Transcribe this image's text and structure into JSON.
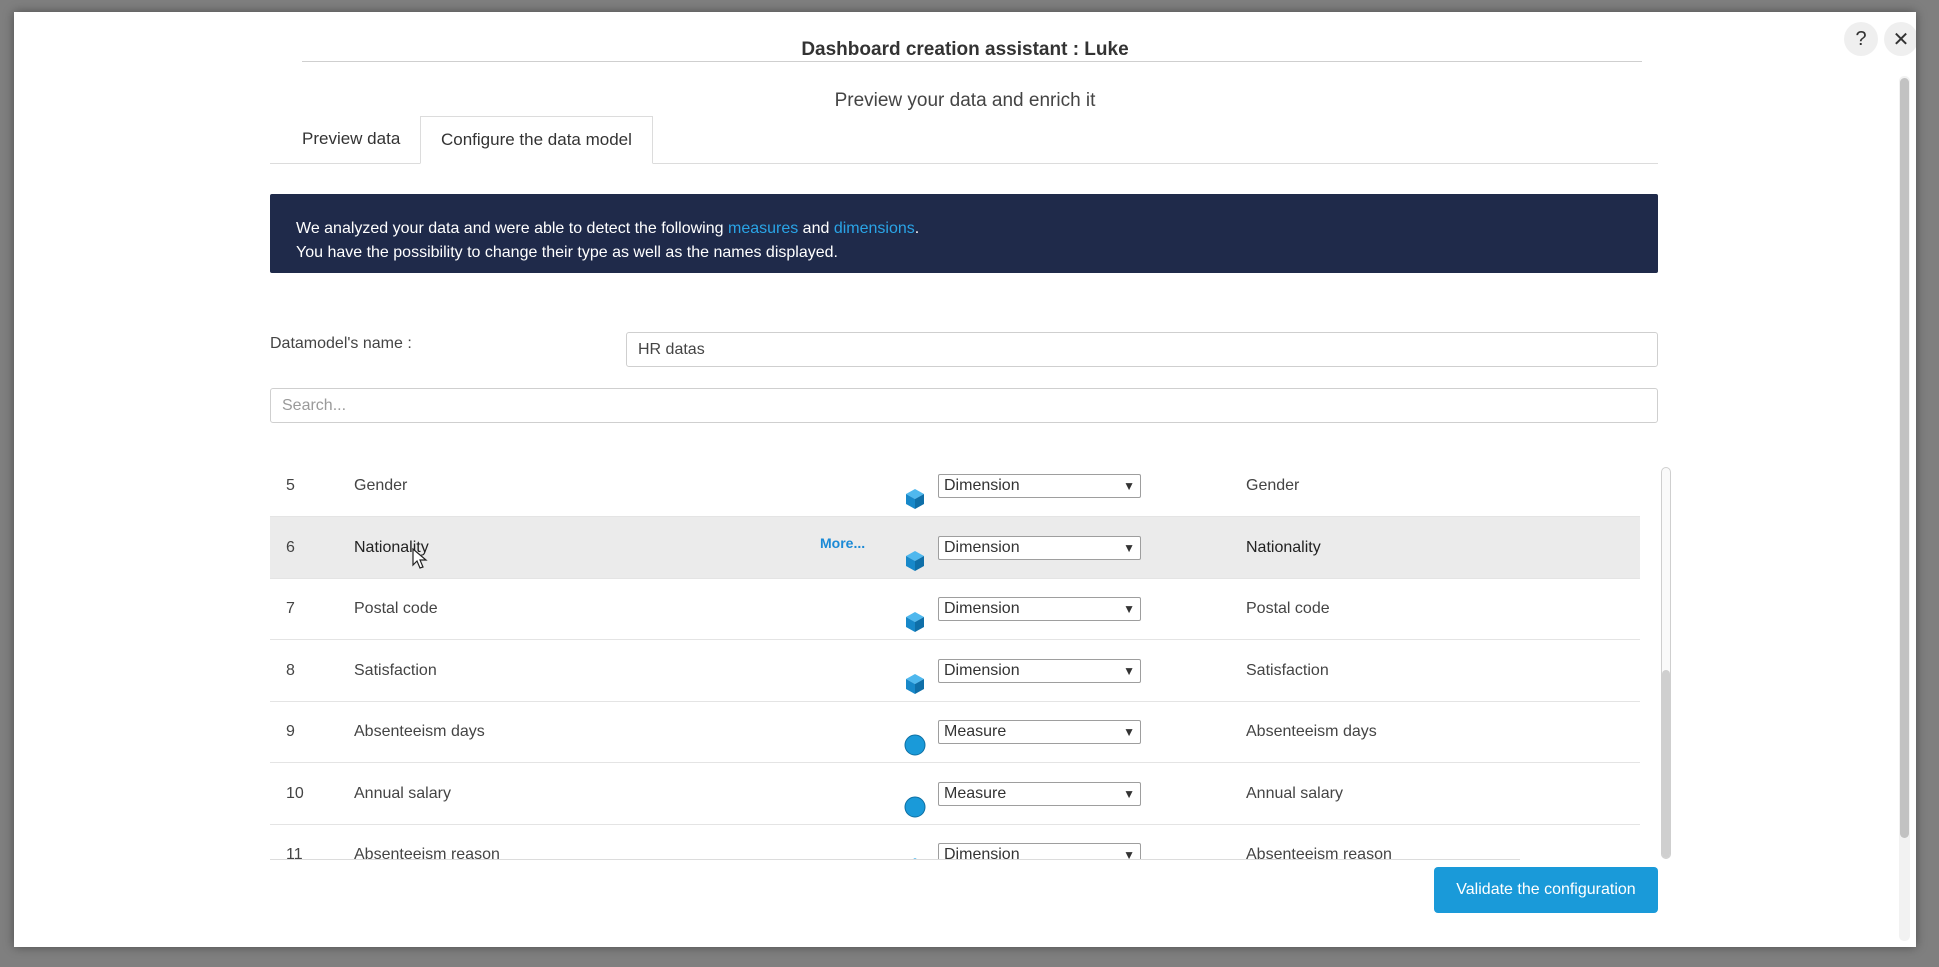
{
  "window": {
    "title": "Dashboard creation assistant : Luke",
    "help_label": "?",
    "close_label": "✕"
  },
  "subtitle": "Preview your data and enrich it",
  "tabs": [
    {
      "label": "Preview data",
      "active": false
    },
    {
      "label": "Configure the data model",
      "active": true
    }
  ],
  "banner": {
    "line1_pre": "We analyzed your data and were able to detect the following ",
    "measures": "measures",
    "and": " and ",
    "dimensions": "dimensions",
    "line1_post": ".",
    "line2": "You have the possibility to change their type as well as the names displayed."
  },
  "datamodel": {
    "label": "Datamodel's name :",
    "value": "HR datas"
  },
  "search": {
    "placeholder": "Search..."
  },
  "more_label": "More...",
  "rows": [
    {
      "num": "5",
      "field": "Gender",
      "icon": "cube-icon",
      "type": "Dimension",
      "display": "Gender"
    },
    {
      "num": "6",
      "field": "Nationality",
      "icon": "cube-icon",
      "type": "Dimension",
      "display": "Nationality",
      "highlighted": true
    },
    {
      "num": "7",
      "field": "Postal code",
      "icon": "cube-icon",
      "type": "Dimension",
      "display": "Postal code"
    },
    {
      "num": "8",
      "field": "Satisfaction",
      "icon": "cube-icon",
      "type": "Dimension",
      "display": "Satisfaction"
    },
    {
      "num": "9",
      "field": "Absenteeism days",
      "icon": "circle-icon",
      "type": "Measure",
      "display": "Absenteeism days"
    },
    {
      "num": "10",
      "field": "Annual salary",
      "icon": "circle-icon",
      "type": "Measure",
      "display": "Annual salary"
    },
    {
      "num": "11",
      "field": "Absenteeism reason",
      "icon": "cube-icon",
      "type": "Dimension",
      "display": "Absenteeism reason"
    }
  ],
  "validate_label": "Validate the configuration",
  "colors": {
    "accent": "#1a9ad9",
    "banner_bg": "#1f2a4a",
    "link": "#2aa4e6"
  }
}
